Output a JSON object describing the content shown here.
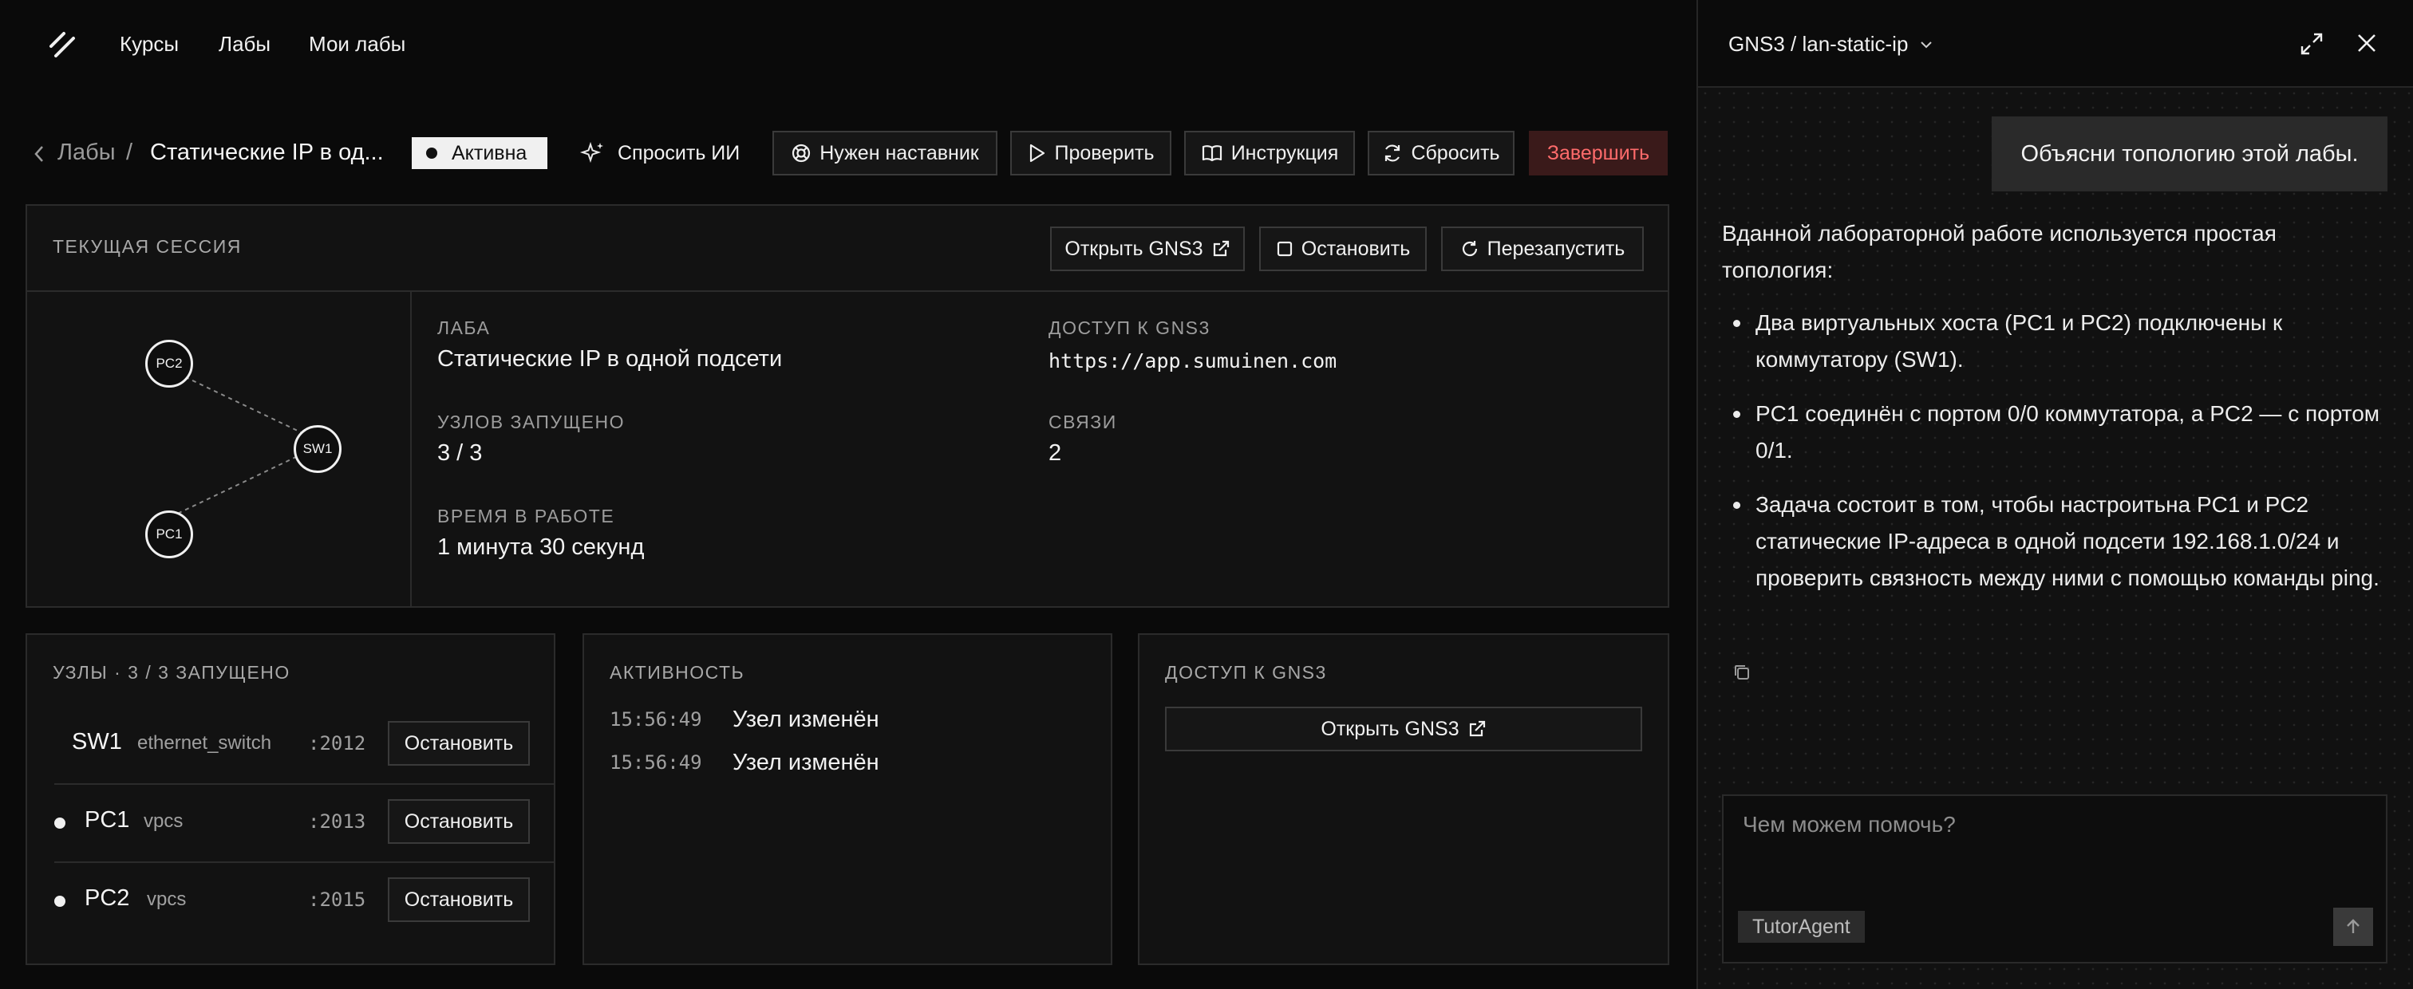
{
  "nav": {
    "links": [
      "Курсы",
      "Лабы",
      "Мои лабы"
    ]
  },
  "labbar": {
    "breadcrumb_back": "Лабы",
    "breadcrumb_sep": "/",
    "title": "Статические IP в од...",
    "status": "Активна",
    "ask_ai": "Спросить ИИ",
    "mentor": "Нужен наставник",
    "check": "Проверить",
    "instruction": "Инструкция",
    "reset": "Сбросить",
    "finish": "Завершить"
  },
  "session": {
    "header": "ТЕКУЩАЯ СЕССИЯ",
    "open_gns3": "Открыть GNS3",
    "stop": "Остановить",
    "restart": "Перезапустить",
    "topology": {
      "nodes": [
        "PC2",
        "SW1",
        "PC1"
      ]
    },
    "lab_label": "ЛАБА",
    "lab_value": "Статические IP в одной подсети",
    "access_label": "ДОСТУП К GNS3",
    "access_value": "https://app.sumuinen.com",
    "nodes_label": "УЗЛОВ ЗАПУЩЕНО",
    "nodes_value": "3 / 3",
    "links_label": "СВЯЗИ",
    "links_value": "2",
    "uptime_label": "ВРЕМЯ В РАБОТЕ",
    "uptime_value": "1 минута 30 секунд"
  },
  "nodes_card": {
    "header": "УЗЛЫ · 3 / 3 ЗАПУЩЕНО",
    "rows": [
      {
        "name": "SW1",
        "type": "ethernet_switch",
        "port": ":2012",
        "action": "Остановить"
      },
      {
        "name": "PC1",
        "type": "vpcs",
        "port": ":2013",
        "action": "Остановить"
      },
      {
        "name": "PC2",
        "type": "vpcs",
        "port": ":2015",
        "action": "Остановить"
      }
    ]
  },
  "activity_card": {
    "header": "АКТИВНОСТЬ",
    "items": [
      {
        "time": "15:56:49",
        "text": "Узел изменён"
      },
      {
        "time": "15:56:49",
        "text": "Узел изменён"
      }
    ]
  },
  "access_card": {
    "header": "ДОСТУП К GNS3",
    "button": "Открыть GNS3"
  },
  "panel": {
    "title": "GNS3 / lan-static-ip",
    "user_message": "Объясни топологию этой лабы.",
    "answer_intro": "Вданной лабораторной работе используется простая топология:",
    "answer_items": [
      "Два виртуальных хоста (PC1 и PC2) подключены к коммутатору (SW1).",
      "PC1 соединён с портом 0/0 коммутатора, а PC2 — с портом 0/1.",
      "Задача состоит в том, чтобы настроитьна PC1 и PC2 статические IP-адреса в одной подсети 192.168.1.0/24 и проверить связность между ними с помощью команды ping."
    ],
    "composer_placeholder": "Чем можем помочь?",
    "agent": "TutorAgent"
  },
  "colors": {
    "background": "#0a0a0a",
    "card": "#121212",
    "border": "#2b2b2b",
    "danger_text": "#ff6b6b",
    "danger_bg": "#3a1a1a",
    "badge_bg": "#f0f0f0"
  }
}
